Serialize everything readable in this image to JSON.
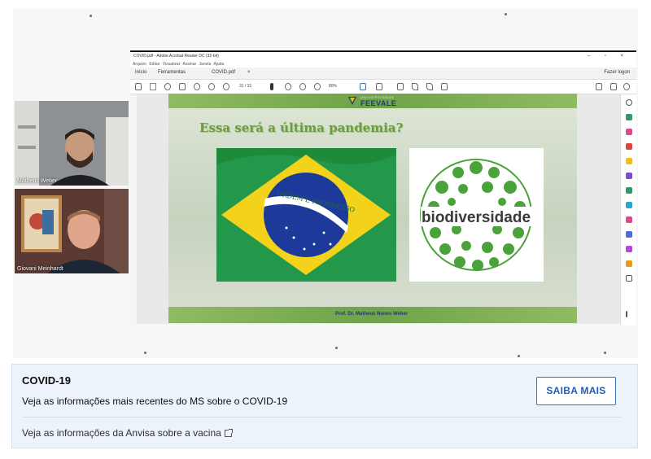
{
  "participants": [
    {
      "name": "Matheus Weber"
    },
    {
      "name": "Giovani Meinhardt"
    }
  ],
  "acrobat": {
    "title": "COVID.pdf - Adobe Acrobat Reader DC (32-bit)",
    "menu": "Arquivo  Editar  Visualizar  Assinar  Janela  Ajuda",
    "tabs": [
      "Início",
      "Ferramentas",
      "COVID.pdf"
    ],
    "sign_in": "Fazer logon",
    "page_indicator": "31 / 31",
    "zoom": "80%"
  },
  "slide": {
    "logo_sub": "UNIVERSIDADE",
    "logo": "FEEVALE",
    "title": "Essa será a última pandemia?",
    "flag_motto": "ORDEM E PROGRESSO",
    "bio_word": "biodiversidade",
    "author": "Prof. Dr. Matheus Nunes Weber"
  },
  "info_card": {
    "title": "COVID-19",
    "line1": "Veja as informações mais recentes do MS sobre o COVID-19",
    "line2": "Veja as informações da Anvisa sobre a vacina",
    "button": "SAIBA MAIS",
    "link_icon": "external-link-icon"
  },
  "colors": {
    "slide_green": "#6fa24a",
    "title_green": "#6a9e3e",
    "button_blue": "#1f5db8",
    "card_bg": "#edf3fa"
  }
}
